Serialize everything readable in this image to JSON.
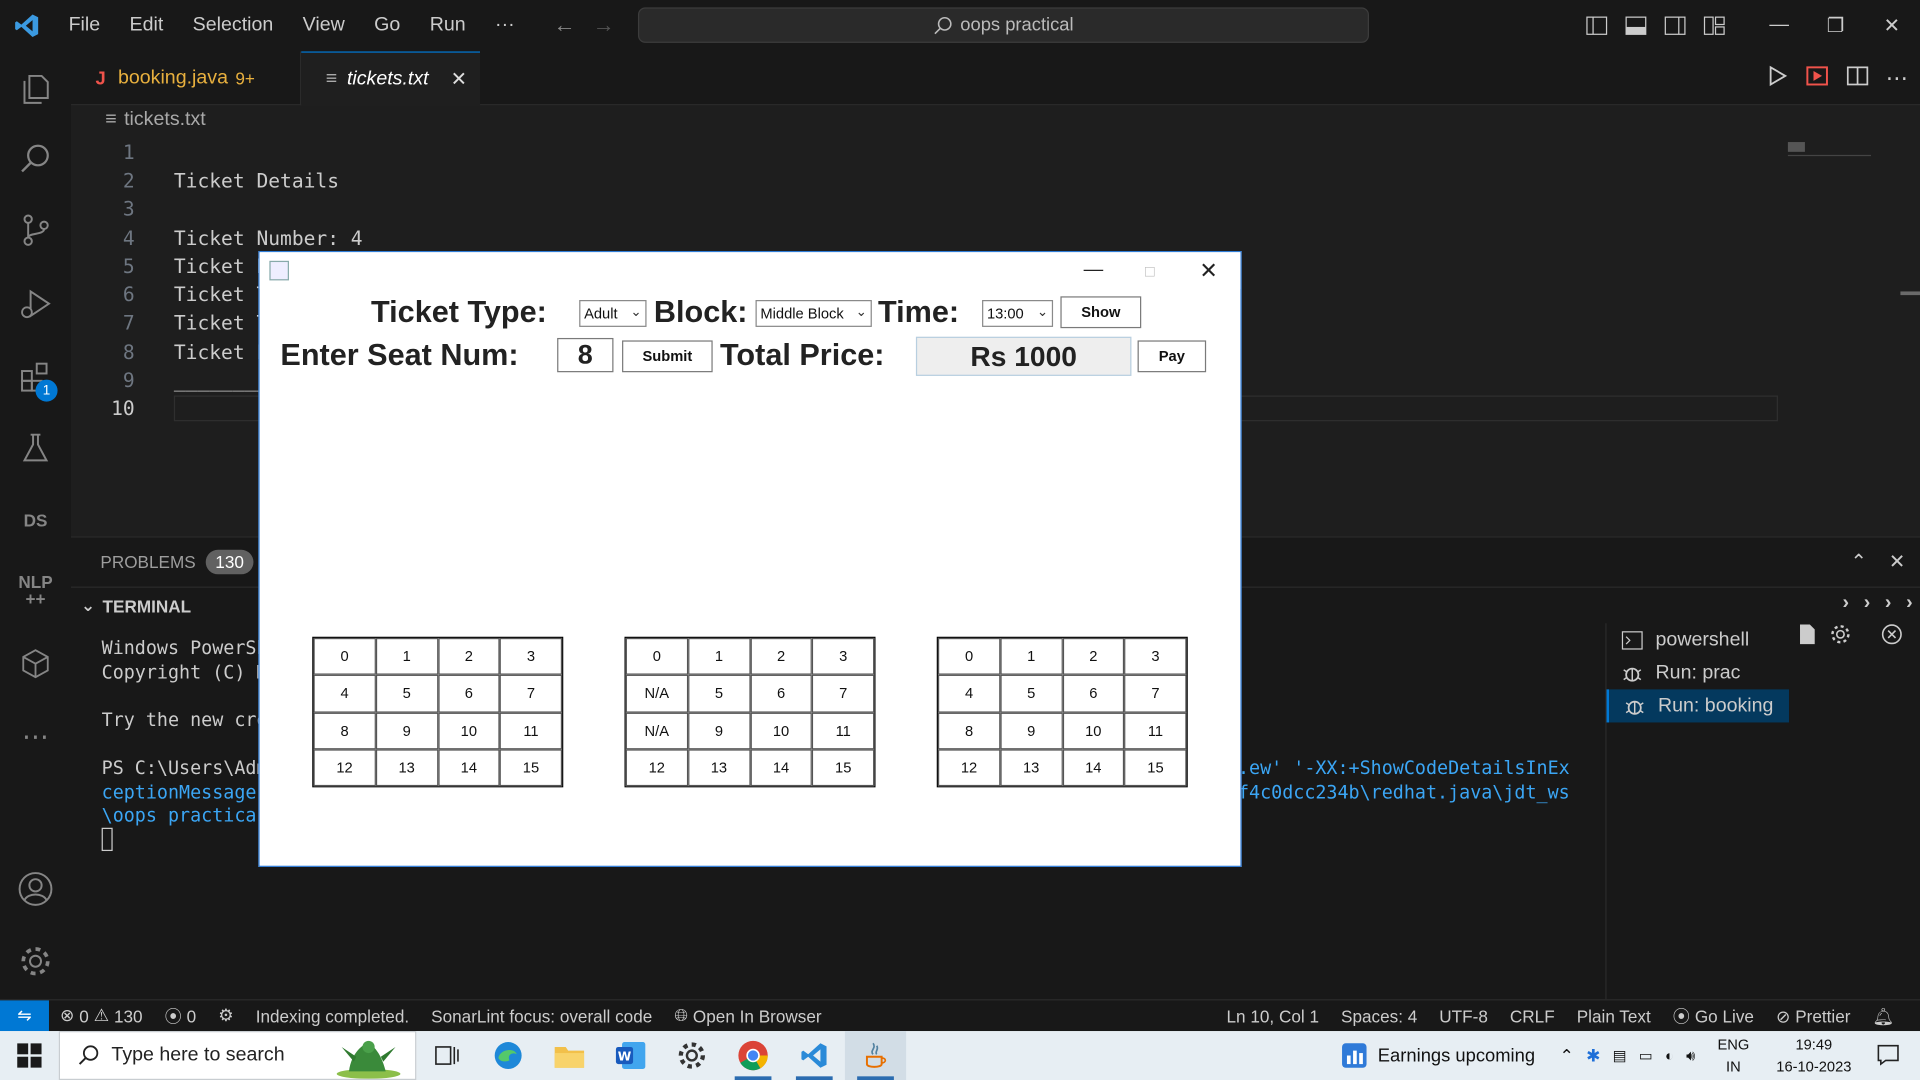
{
  "titlebar": {
    "menu": [
      "File",
      "Edit",
      "Selection",
      "View",
      "Go",
      "Run",
      "···"
    ],
    "search": "oops practical"
  },
  "tabs": [
    {
      "label": "booking.java",
      "badge": "9+",
      "icon": "java-icon"
    },
    {
      "label": "tickets.txt",
      "icon": "text-file-icon"
    }
  ],
  "breadcrumb": "tickets.txt",
  "editor": {
    "lines": [
      {
        "n": "1",
        "text": ""
      },
      {
        "n": "2",
        "text": "Ticket Details"
      },
      {
        "n": "3",
        "text": ""
      },
      {
        "n": "4",
        "text": "Ticket Number: 4"
      },
      {
        "n": "5",
        "text": "Ticket B"
      },
      {
        "n": "6",
        "text": "Ticket T"
      },
      {
        "n": "7",
        "text": "Ticket T"
      },
      {
        "n": "8",
        "text": "Ticket E"
      },
      {
        "n": "9",
        "text": "________"
      },
      {
        "n": "10",
        "text": ""
      }
    ]
  },
  "activity_bar": {
    "extensions_badge": "1",
    "ds_label": "DS",
    "nlp_label": "NLP\n++"
  },
  "panel": {
    "problems_label": "PROBLEMS",
    "problems_count": "130",
    "terminal_label": "TERMINAL",
    "terminal_lines": [
      "Windows PowerSh",
      "Copyright (C) M",
      "",
      "Try the new cro",
      "",
      "PS C:\\Users\\Adm"
    ],
    "terminal_lines_blue": [
      "ceptionMessage",
      "\\oops practica"
    ],
    "terminal_right_blue": [
      ".ew' '-XX:+ShowCodeDetailsInEx",
      "f4c0dcc234b\\redhat.java\\jdt_ws"
    ],
    "terminals": [
      {
        "label": "powershell",
        "icon": "terminal-icon"
      },
      {
        "label": "Run: prac",
        "icon": "debug-icon"
      },
      {
        "label": "Run: booking",
        "icon": "debug-icon",
        "selected": true
      }
    ]
  },
  "statusbar": {
    "errors": "0",
    "warnings": "130",
    "ports": "0",
    "indexing": "Indexing completed.",
    "sonarlint": "SonarLint focus: overall code",
    "open_browser": "Open In Browser",
    "position": "Ln 10, Col 1",
    "spaces": "Spaces: 4",
    "encoding": "UTF-8",
    "eol": "CRLF",
    "language": "Plain Text",
    "golive": "Go Live",
    "prettier": "Prettier"
  },
  "taskbar": {
    "search_placeholder": "Type here to search",
    "earnings": "Earnings upcoming",
    "lang_top": "ENG",
    "lang_bottom": "IN",
    "time": "19:49",
    "date": "16-10-2023"
  },
  "dialog": {
    "ticket_type_label": "Ticket Type:",
    "ticket_type_value": "Adult",
    "block_label": "Block:",
    "block_value": "Middle Block",
    "time_label": "Time:",
    "time_value": "13:00",
    "show_button": "Show",
    "seat_label": "Enter Seat Num:",
    "seat_value": "8",
    "submit_button": "Submit",
    "price_label": "Total Price:",
    "price_value": "Rs 1000",
    "pay_button": "Pay",
    "grids": [
      [
        "0",
        "1",
        "2",
        "3",
        "4",
        "5",
        "6",
        "7",
        "8",
        "9",
        "10",
        "11",
        "12",
        "13",
        "14",
        "15"
      ],
      [
        "0",
        "1",
        "2",
        "3",
        "N/A",
        "5",
        "6",
        "7",
        "N/A",
        "9",
        "10",
        "11",
        "12",
        "13",
        "14",
        "15"
      ],
      [
        "0",
        "1",
        "2",
        "3",
        "4",
        "5",
        "6",
        "7",
        "8",
        "9",
        "10",
        "11",
        "12",
        "13",
        "14",
        "15"
      ]
    ]
  }
}
